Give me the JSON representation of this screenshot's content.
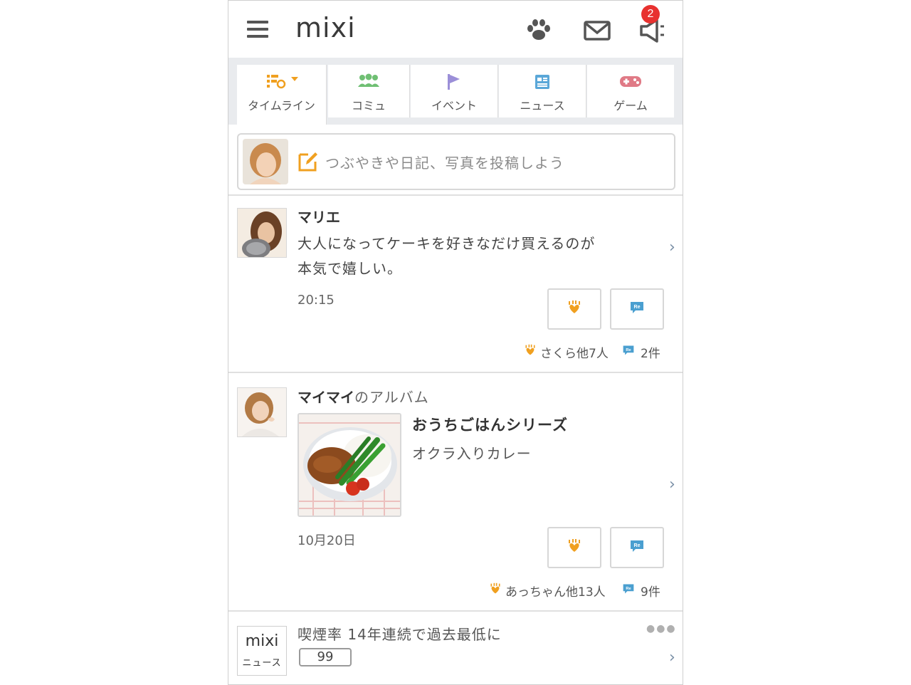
{
  "header": {
    "logo": "mixi",
    "notification_count": "2",
    "icons": [
      "menu-icon",
      "paw-icon",
      "mail-icon",
      "megaphone-icon"
    ]
  },
  "tabs": [
    {
      "label": "タイムライン",
      "icon": "timeline-list-icon",
      "active": true
    },
    {
      "label": "コミュ",
      "icon": "community-icon"
    },
    {
      "label": "イベント",
      "icon": "flag-icon"
    },
    {
      "label": "ニュース",
      "icon": "news-icon"
    },
    {
      "label": "ゲーム",
      "icon": "gamepad-icon"
    }
  ],
  "compose": {
    "placeholder": "つぶやきや日記、写真を投稿しよう"
  },
  "posts": [
    {
      "name": "マリエ",
      "text_line1": "大人になってケーキを好きなだけ買えるのが",
      "text_line2": "本気で嬉しい。",
      "time": "20:15",
      "likes": "さくら他7人",
      "comments": "2件"
    },
    {
      "name": "マイマイ",
      "name_suffix": "のアルバム",
      "album_title": "おうちごはんシリーズ",
      "album_sub": "オクラ入りカレー",
      "time": "10月20日",
      "likes": "あっちゃん他13人",
      "comments": "9件"
    }
  ],
  "news": {
    "logo_top": "mixi",
    "logo_bottom": "ニュース",
    "headline": "喫煙率 14年連続で過去最低に",
    "count": "99"
  },
  "colors": {
    "accent_orange": "#f0a020",
    "badge_red": "#e8312f",
    "re_blue": "#4a9fd0",
    "community_green": "#6fbf73",
    "flag_purple": "#9b8fd8",
    "news_blue": "#5aa7d8",
    "game_pink": "#e07a86"
  }
}
